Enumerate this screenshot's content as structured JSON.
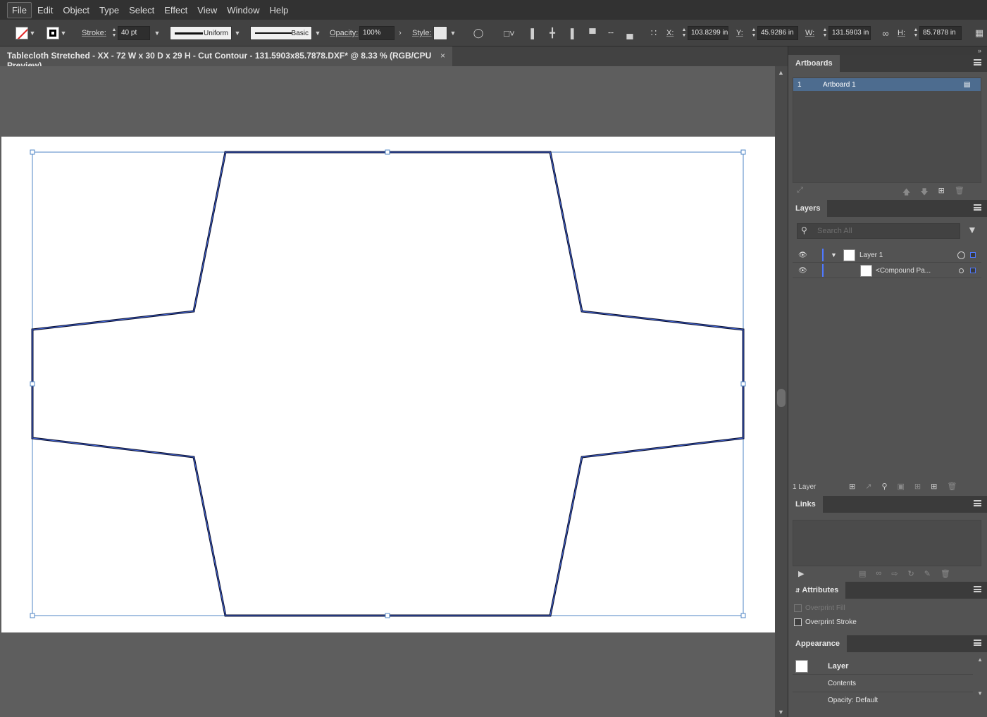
{
  "menu": [
    "File",
    "Edit",
    "Object",
    "Type",
    "Select",
    "Effect",
    "View",
    "Window",
    "Help"
  ],
  "control": {
    "stroke_label": "Stroke:",
    "stroke_weight": "40 pt",
    "profile": "Uniform",
    "brush": "Basic",
    "opacity_label": "Opacity:",
    "opacity": "100%",
    "style_label": "Style:",
    "x_label": "X:",
    "x_value": "103.8299 in",
    "y_label": "Y:",
    "y_value": "45.9286 in",
    "w_label": "W:",
    "w_value": "131.5903 in",
    "h_label": "H:",
    "h_value": "85.7878 in"
  },
  "document": {
    "tab_title": "Tablecloth Stretched - XX - 72 W x 30 D x 29 H - Cut Contour - 131.5903x85.7878.DXF* @ 8.33 % (RGB/CPU Preview)",
    "close_glyph": "×"
  },
  "artboards_panel": {
    "title": "Artboards",
    "rows": [
      {
        "index": "1",
        "name": "Artboard 1"
      }
    ]
  },
  "layers_panel": {
    "title": "Layers",
    "search_placeholder": "Search All",
    "rows": [
      {
        "name": "Layer 1"
      },
      {
        "name": "<Compound Pa..."
      }
    ],
    "count": "1 Layer"
  },
  "links_panel": {
    "title": "Links"
  },
  "attributes_panel": {
    "title": "Attributes",
    "overprint_fill": "Overprint Fill",
    "overprint_stroke": "Overprint Stroke"
  },
  "appearance_panel": {
    "title": "Appearance",
    "rows": [
      "Layer",
      "Contents",
      "Opacity: Default"
    ]
  },
  "colors": {
    "panel_bg": "#535353",
    "selection_blue": "#4f79ff",
    "artboard_highlight": "#4d6c8f",
    "stroke_color": "#0b1130"
  }
}
